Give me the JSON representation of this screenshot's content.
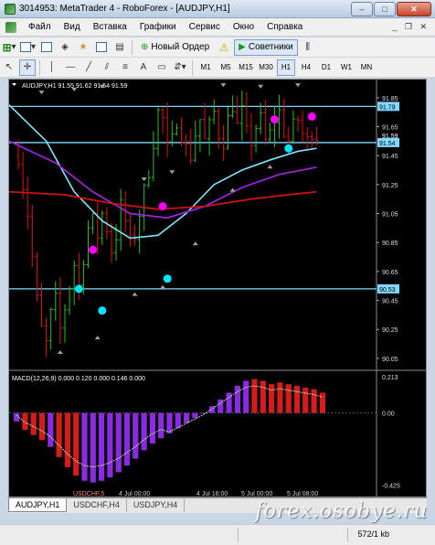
{
  "window": {
    "title": "3014953: MetaTrader 4 - RoboForex - [AUDJPY,H1]"
  },
  "menu": [
    "Файл",
    "Вид",
    "Вставка",
    "Графики",
    "Сервис",
    "Окно",
    "Справка"
  ],
  "toolbar": {
    "new_order": "Новый Ордер",
    "advisors": "Советники"
  },
  "timeframes": [
    "M1",
    "M5",
    "M15",
    "M30",
    "H1",
    "H4",
    "D1",
    "W1",
    "MN"
  ],
  "active_timeframe": "H1",
  "chart": {
    "header": "AUDJPY,H1  91.55 91.62 91.54 91.59",
    "indicator_label": "MACD(12,26,9) 0.000 0.120 0.000 0.146 0.000",
    "price_ticks": [
      "91.85",
      "91.65",
      "91.45",
      "91.25",
      "91.05",
      "90.85",
      "90.65",
      "90.45",
      "90.25",
      "90.05"
    ],
    "macd_ticks": [
      "0.213",
      "0.00",
      "-0.425"
    ],
    "hlines": [
      {
        "price": 91.79,
        "label": "91.79"
      },
      {
        "price": 91.54,
        "label": "91.54"
      },
      {
        "price": 90.53,
        "label": "90.53"
      }
    ],
    "current_price": "91.59",
    "time_labels": [
      "USDCHF,5",
      "4 Jul 00:00",
      "4 Jul 16:00",
      "5 Jul 00:00",
      "5 Jul 08:00"
    ],
    "colors": {
      "bull": "#22c222",
      "bear": "#e01010",
      "ma_fast": "#7fe6ff",
      "ma_mid": "#9a22d8",
      "ma_slow": "#cc1111",
      "hline": "#80d8ff",
      "dot_cyan": "#00e5ff",
      "dot_magenta": "#ff00ff"
    }
  },
  "symbol_tabs": [
    "AUDJPY,H1",
    "USDCHF,H4",
    "USDJPY,H4"
  ],
  "active_tab": "AUDJPY,H1",
  "status": {
    "size": "572/1 kb"
  },
  "watermark": "forex.osobye.ru"
}
